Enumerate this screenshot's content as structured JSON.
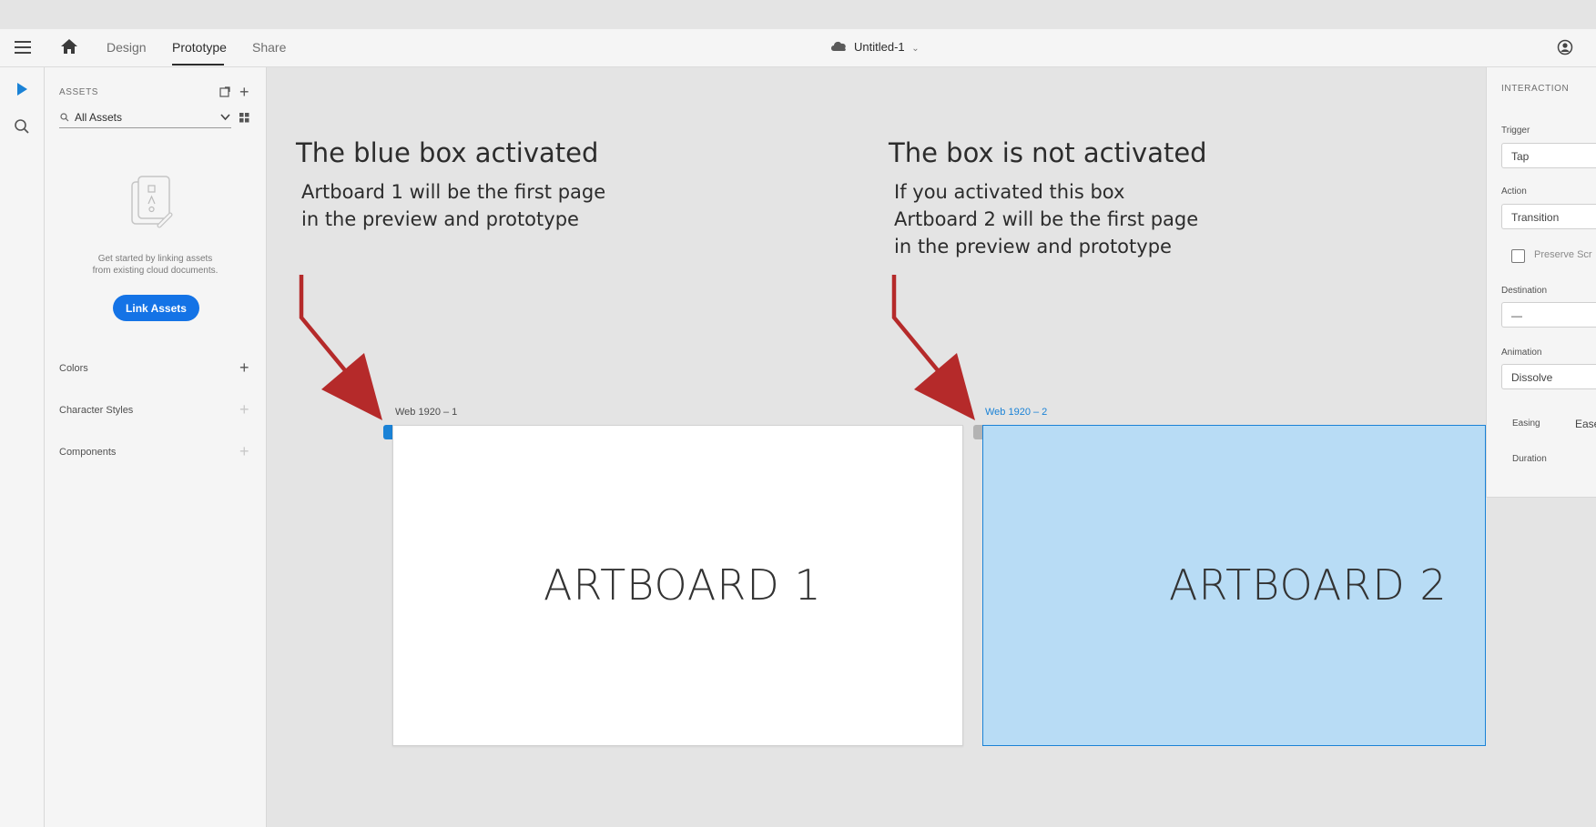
{
  "topbar": {
    "tabs": [
      "Design",
      "Prototype",
      "Share"
    ],
    "active_tab": "Prototype",
    "document_title": "Untitled-1"
  },
  "assets_panel": {
    "heading": "ASSETS",
    "filter_value": "All Assets",
    "empty_message_line1": "Get started by linking assets",
    "empty_message_line2": "from existing cloud documents.",
    "link_button": "Link Assets",
    "sections": [
      "Colors",
      "Character Styles",
      "Components"
    ]
  },
  "annotations": {
    "left_title": "The blue box activated",
    "left_body": [
      "Artboard 1 will be the first page",
      "in the preview and prototype"
    ],
    "right_title": "The box is not activated",
    "right_body": [
      "If you activated this box",
      "Artboard 2 will be the first page",
      "in the preview and prototype"
    ]
  },
  "artboards": [
    {
      "label": "Web 1920 – 1",
      "text": "ARTBOARD 1",
      "fill": "#ffffff",
      "home_marker": "active"
    },
    {
      "label": "Web 1920 – 2",
      "text": "ARTBOARD 2",
      "fill": "#b8dcf5",
      "home_marker": "inactive",
      "selected": true
    }
  ],
  "interaction_panel": {
    "heading": "INTERACTION",
    "trigger_label": "Trigger",
    "trigger_value": "Tap",
    "action_label": "Action",
    "action_value": "Transition",
    "preserve_label": "Preserve Scr",
    "destination_label": "Destination",
    "destination_value": "—",
    "animation_label": "Animation",
    "animation_value": "Dissolve",
    "easing_label": "Easing",
    "easing_value": "Ease",
    "duration_label": "Duration"
  },
  "colors": {
    "accent": "#1473e6",
    "arrow": "#b52a2a",
    "selection_blue": "#1a82d6",
    "artboard2_fill": "#b8dcf5"
  }
}
